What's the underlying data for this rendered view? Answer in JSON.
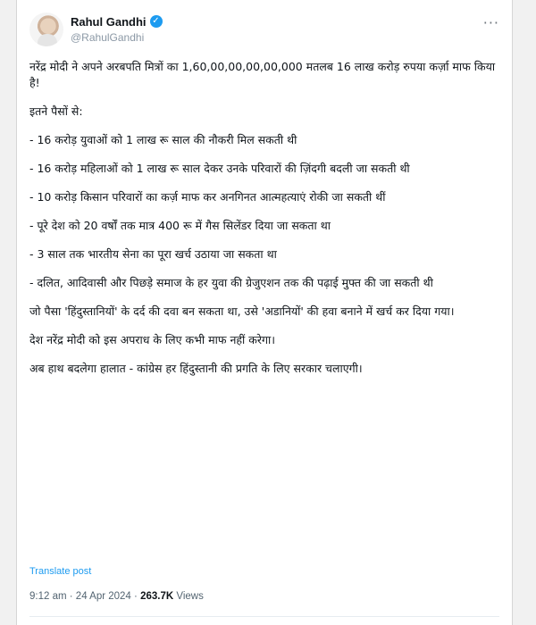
{
  "author": {
    "name": "Rahul Gandhi",
    "handle": "@RahulGandhi",
    "verified": true
  },
  "more_menu": "···",
  "tweet": {
    "paragraphs": [
      "नरेंद्र मोदी ने अपने अरबपति मित्रों का 1,60,00,00,00,00,000 मतलब 16 लाख करोड़ रुपया कर्ज़ा माफ किया है!",
      "इतने पैसों से:",
      "- 16 करोड़ युवाओं को 1 लाख रू साल की नौकरी मिल सकती थी",
      "- 16 करोड़ महिलाओं को 1 लाख रू साल देकर उनके परिवारों की ज़िंदगी बदली जा सकती थी",
      "- 10 करोड़ किसान परिवारों का कर्ज़ माफ कर अनगिनत आत्महत्याएं रोकी जा सकती थीं",
      "- पूरे देश को 20 वर्षों तक मात्र 400 रू में गैस सिलेंडर दिया जा सकता था",
      "- 3 साल तक भारतीय सेना का पूरा खर्च उठाया जा सकता था",
      "- दलित, आदिवासी और पिछड़े समाज के हर युवा की ग्रेजुएशन तक की पढ़ाई मुफ्त की जा सकती थी",
      "जो पैसा 'हिंदुस्तानियों' के दर्द की दवा बन सकता था, उसे 'अडानियों' की हवा बनाने में खर्च कर दिया गया।",
      "देश नरेंद्र मोदी को इस अपराध के लिए कभी माफ नहीं करेगा।",
      "अब हाथ बदलेगा हालात - कांग्रेस हर हिंदुस्तानी की प्रगति के लिए सरकार चलाएगी।"
    ],
    "translate_label": "Translate post",
    "time": "9:12 am",
    "date": "24 Apr 2024",
    "views_count": "263.7K",
    "views_label": "Views"
  }
}
